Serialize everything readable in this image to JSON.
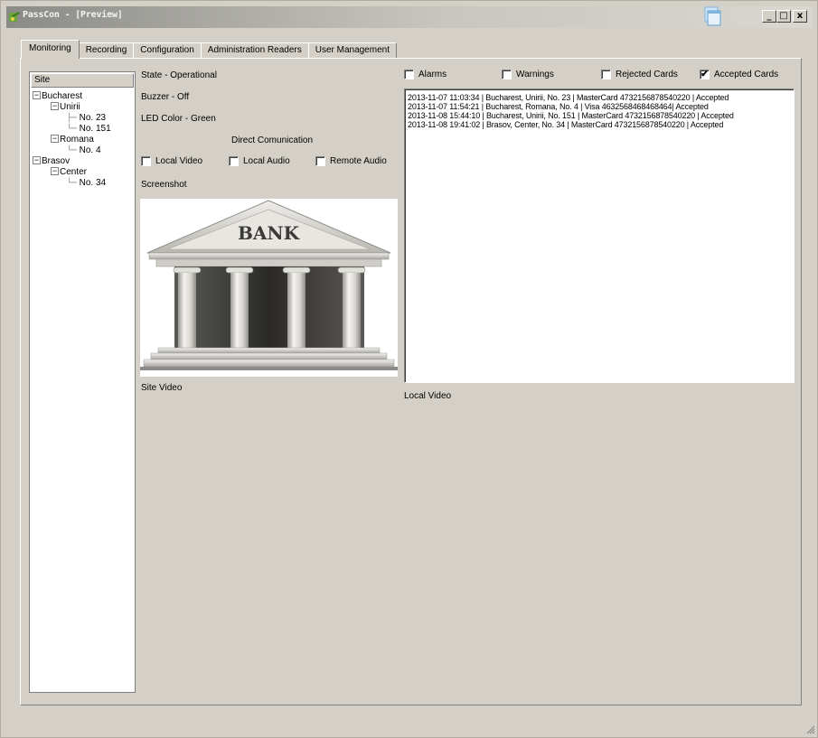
{
  "window": {
    "title": "PassCon - [Preview]",
    "minimize_glyph": "_",
    "maximize_glyph": "□",
    "close_glyph": "x"
  },
  "tabs": [
    {
      "label": "Monitoring",
      "active": true
    },
    {
      "label": "Recording",
      "active": false
    },
    {
      "label": "Configuration",
      "active": false
    },
    {
      "label": "Administration Readers",
      "active": false
    },
    {
      "label": "User Management",
      "active": false
    }
  ],
  "site_tree": {
    "header": "Site",
    "nodes": [
      {
        "label": "Bucharest",
        "expandable": true
      },
      {
        "label": "Unirii",
        "expandable": true
      },
      {
        "label": "No. 23",
        "expandable": false
      },
      {
        "label": "No. 151",
        "expandable": false
      },
      {
        "label": "Romana",
        "expandable": true
      },
      {
        "label": "No. 4",
        "expandable": false
      },
      {
        "label": "Brasov",
        "expandable": true
      },
      {
        "label": "Center",
        "expandable": true
      },
      {
        "label": "No. 34",
        "expandable": false
      }
    ]
  },
  "status": {
    "state": "State - Operational",
    "buzzer": "Buzzer - Off",
    "led_color": "LED Color - Green",
    "direct_communication": "Direct Comunication"
  },
  "media_checkboxes": [
    {
      "label": "Local Video",
      "checked": false
    },
    {
      "label": "Local Audio",
      "checked": false
    },
    {
      "label": "Remote Audio",
      "checked": false
    }
  ],
  "screenshot": {
    "label": "Screenshot",
    "image_text": "BANK",
    "icon": "bank-building"
  },
  "site_video_label": "Site Video",
  "local_video_label": "Local Video",
  "filters": [
    {
      "label": "Alarms",
      "checked": false
    },
    {
      "label": "Warnings",
      "checked": false
    },
    {
      "label": "Rejected Cards",
      "checked": false
    },
    {
      "label": "Accepted Cards",
      "checked": true
    }
  ],
  "log_entries": [
    "2013-11-07 11:03:34 | Bucharest, Unirii, No. 23   | MasterCard 4732156878540220 | Accepted",
    "2013-11-07 11:54:21 | Bucharest, Romana, No. 4 | Visa          4632568468468464| Accepted",
    "2013-11-08 15:44:10 | Bucharest, Unirii, No. 151 | MasterCard 4732156878540220 | Accepted",
    "2013-11-08 19:41:02 | Brasov, Center, No. 34     | MasterCard 4732156878540220 | Accepted"
  ],
  "check_glyph": "✔",
  "colors": {
    "window_bg": "#d4d0c8",
    "title_gradient_start": "#8a8a86",
    "title_gradient_end": "#d9d7d1",
    "app_icon_green": "#5a9a2e",
    "tray_icon_blue": "#7fb6e0"
  }
}
